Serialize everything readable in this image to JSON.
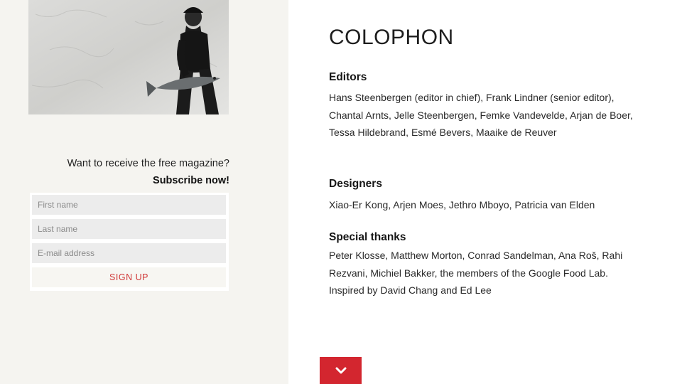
{
  "sidebar": {
    "photo": {
      "subject": "man-carrying-fish-photo"
    },
    "promo": {
      "question": "Want to receive the free magazine?",
      "cta": "Subscribe now!"
    },
    "form": {
      "first_name_placeholder": "First name",
      "last_name_placeholder": "Last name",
      "email_placeholder": "E-mail address",
      "signup_label": "SIGN UP"
    }
  },
  "main": {
    "title": "COLOPHON",
    "sections": [
      {
        "heading": "Editors",
        "body": "Hans Steenbergen (editor in chief), Frank Lindner (senior editor), Chantal Arnts, Jelle Steenbergen, Femke Vandevelde, Arjan de Boer, Tessa Hildebrand, Esmé Bevers, Maaike de Reuver"
      },
      {
        "heading": "Designers",
        "body": "Xiao-Er Kong, Arjen Moes, Jethro Mboyo, Patricia van Elden"
      },
      {
        "heading": "Special thanks",
        "body": "Peter Klosse, Matthew Morton, Conrad Sandelman, Ana Roš, Rahi Rezvani, Michiel Bakker, the members of the Google Food Lab. Inspired by David Chang and Ed Lee"
      }
    ]
  },
  "scroll_down": {
    "icon": "chevron-down-icon"
  },
  "colors": {
    "accent": "#d3262f",
    "signup_text": "#d03838",
    "sidebar_bg": "#f5f4f0"
  }
}
